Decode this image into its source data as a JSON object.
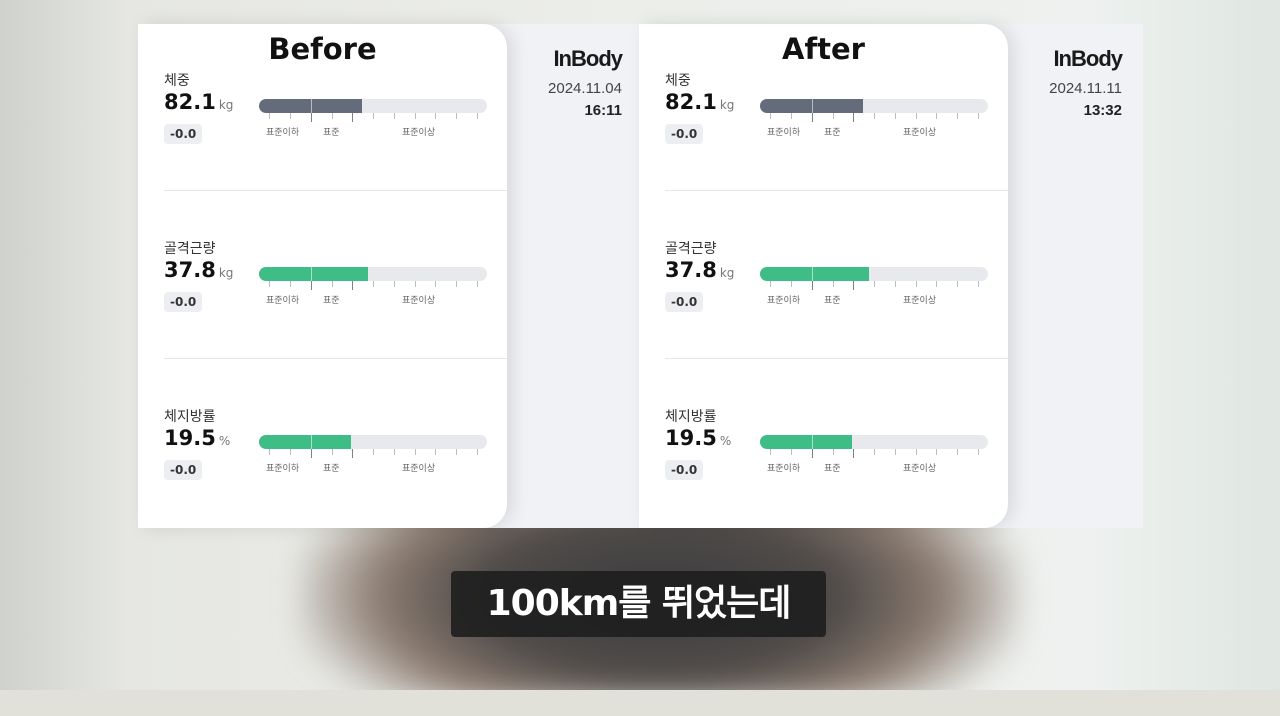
{
  "labels": {
    "below": "표준이하",
    "normal": "표준",
    "above": "표준이상"
  },
  "colors": {
    "weight_bar": "#646b7b",
    "green_bar": "#3fbd86"
  },
  "panels": [
    {
      "title": "Before",
      "brand": "InBody",
      "date": "2024.11.04",
      "time": "16:11",
      "metrics": [
        {
          "label": "체중",
          "value": "82.1",
          "unit": "kg",
          "change": "-0.0",
          "level": 0.45,
          "color": "#646b7b"
        },
        {
          "label": "골격근량",
          "value": "37.8",
          "unit": "kg",
          "change": "-0.0",
          "level": 0.48,
          "color": "#3fbd86"
        },
        {
          "label": "체지방률",
          "value": "19.5",
          "unit": "%",
          "change": "-0.0",
          "level": 0.405,
          "color": "#3fbd86"
        }
      ]
    },
    {
      "title": "After",
      "brand": "InBody",
      "date": "2024.11.11",
      "time": "13:32",
      "metrics": [
        {
          "label": "체중",
          "value": "82.1",
          "unit": "kg",
          "change": "-0.0",
          "level": 0.45,
          "color": "#646b7b"
        },
        {
          "label": "골격근량",
          "value": "37.8",
          "unit": "kg",
          "change": "-0.0",
          "level": 0.48,
          "color": "#3fbd86"
        },
        {
          "label": "체지방률",
          "value": "19.5",
          "unit": "%",
          "change": "-0.0",
          "level": 0.405,
          "color": "#3fbd86"
        }
      ]
    }
  ],
  "caption": "100km를 뛰었는데"
}
